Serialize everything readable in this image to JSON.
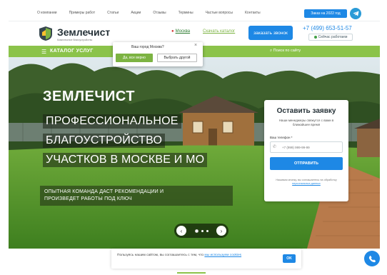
{
  "topnav": {
    "links": [
      "О компании",
      "Примеры работ",
      "Статьи",
      "Акции",
      "Отзывы",
      "Термины",
      "Частые вопросы",
      "Контакты"
    ],
    "callback": "Заказ на 2022 год"
  },
  "header": {
    "brand": "Землечист",
    "brand_sub": "Комплексное благоустройство",
    "city_prefix": "",
    "city": "Москва",
    "catalog_link": "Скачать каталог",
    "order_call": "заказать звонок",
    "phone": "+7 (499) 653-51-57",
    "open_status": "Сейчас работаем"
  },
  "catbar": {
    "catalog": "КАТАЛОГ УСЛУГ",
    "search": "Поиск по сайту"
  },
  "city_popup": {
    "question": "Ваш город Москва?",
    "yes": "Да, все верно",
    "other": "Выбрать другой"
  },
  "hero": {
    "title": "ЗЕМЛЕЧИСТ",
    "line1": "ПРОФЕССИОНАЛЬНОЕ",
    "line2": "БЛАГОУСТРОЙСТВО",
    "line3": "УЧАСТКОВ В МОСКВЕ И МО",
    "sub1": "ОПЫТНАЯ КОМАНДА ДАСТ РЕКОМЕНДАЦИИ И",
    "sub2": "ПРОИЗВЕДЕТ РАБОТЫ ПОД КЛЮЧ"
  },
  "slider": {
    "prev": "‹",
    "next": "›",
    "slides": 3,
    "active": 1
  },
  "form": {
    "title": "Оставить заявку",
    "desc": "Наши менеджеры свяжутся с вами в ближайшее время",
    "phone_label": "Ваш телефон *",
    "phone_placeholder": "+7 (999) 999-99-99",
    "submit": "ОТПРАВИТЬ",
    "legal_text": "Нажимая кнопку, вы соглашаетесь на обработку",
    "legal_link": "персональных данных"
  },
  "cookie": {
    "text": "Пользуясь нашим сайтом, вы соглашаетесь с тем, что",
    "link": "мы используем cookies",
    "ok": "OK"
  },
  "colors": {
    "accent_green": "#8bc34a",
    "accent_blue": "#1e88e5"
  },
  "icons": [
    "telegram-icon",
    "map-pin-icon",
    "hamburger-icon",
    "search-icon",
    "phone-icon",
    "phone-fab-icon"
  ]
}
